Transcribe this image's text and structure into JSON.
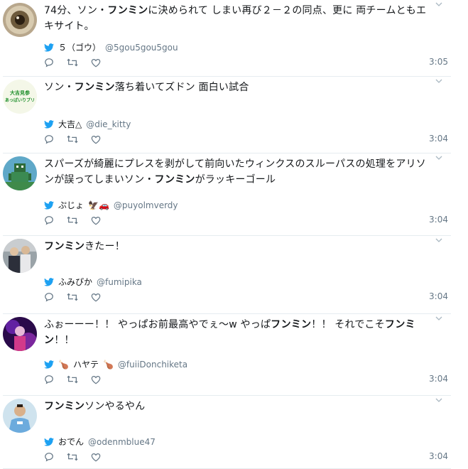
{
  "tweets": [
    {
      "text_parts": [
        {
          "t": "74分、ソン・",
          "b": false
        },
        {
          "t": "フンミン",
          "b": true
        },
        {
          "t": "に決められて しまい再び２－２の同点、更に 両チームともエキサイト。",
          "b": false
        }
      ],
      "name": "５（ゴウ）",
      "handle": "@5gou5gou5gou",
      "time": "3:05",
      "avatar": "eye-closeup"
    },
    {
      "text_parts": [
        {
          "t": "ソン・",
          "b": false
        },
        {
          "t": "フンミン",
          "b": true
        },
        {
          "t": "落ち着いてズドン 面白い試合",
          "b": false
        }
      ],
      "name": "大吉△",
      "handle": "@die_kitty",
      "time": "3:04",
      "avatar": "green-text",
      "avatar_text": [
        "大吉見参",
        "あっぱいりプリ"
      ]
    },
    {
      "text_parts": [
        {
          "t": "スパーズが綺麗にプレスを剥がして前向いたウィンクスのスルーパスの処理をアリソンが誤ってしまいソン・",
          "b": false
        },
        {
          "t": "フンミン",
          "b": true
        },
        {
          "t": "がラッキーゴール",
          "b": false
        }
      ],
      "name": "ぷじょ",
      "name_suffix": "🦅🚗",
      "handle": "@puyolmverdy",
      "time": "3:04",
      "avatar": "pixel-robot"
    },
    {
      "text_parts": [
        {
          "t": "フンミン",
          "b": true
        },
        {
          "t": "きたー！",
          "b": false
        }
      ],
      "name": "ふみぴか",
      "handle": "@fumipika",
      "time": "3:04",
      "avatar": "people-photo"
    },
    {
      "text_parts": [
        {
          "t": "ふぉーーー！！ やっぱお前最高やでぇ〜w やっぱ",
          "b": false
        },
        {
          "t": "フンミン",
          "b": true
        },
        {
          "t": "！！ それでこそ",
          "b": false
        },
        {
          "t": "フンミン",
          "b": true
        },
        {
          "t": "！！",
          "b": false
        }
      ],
      "name": "ハヤテ",
      "name_prefix": "🍗",
      "name_suffix": "🍗",
      "handle": "@fuiiDonchiketa",
      "time": "3:04",
      "avatar": "purple-figure"
    },
    {
      "text_parts": [
        {
          "t": "フンミン",
          "b": true
        },
        {
          "t": "ソンやるやん",
          "b": false
        }
      ],
      "name": "おでん",
      "handle": "@odenmblue47",
      "time": "3:04",
      "avatar": "soccer-player"
    }
  ],
  "colors": {
    "twitter_blue": "#1da1f2",
    "text": "#14171a",
    "muted": "#657786",
    "border": "#e6ecf0"
  }
}
